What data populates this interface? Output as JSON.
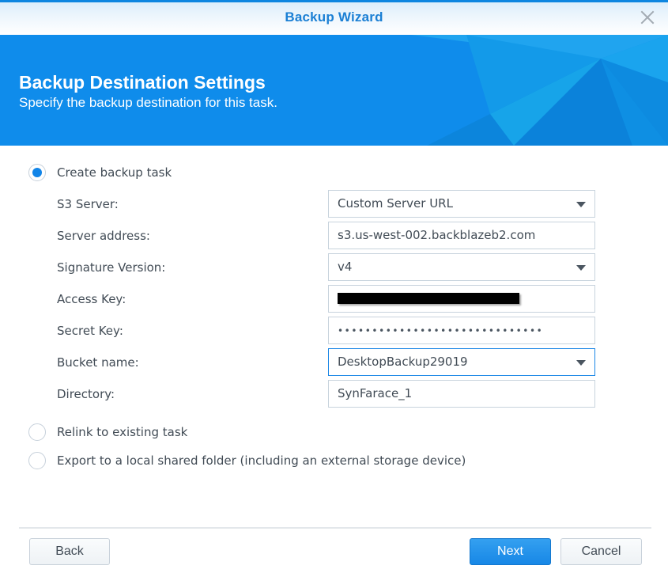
{
  "window": {
    "title": "Backup Wizard",
    "close_icon": "close-icon"
  },
  "banner": {
    "title": "Backup Destination Settings",
    "subtitle": "Specify the backup destination for this task."
  },
  "options": [
    {
      "label": "Create backup task",
      "checked": true
    },
    {
      "label": "Relink to existing task",
      "checked": false
    },
    {
      "label": "Export to a local shared folder (including an external storage device)",
      "checked": false
    }
  ],
  "form": {
    "s3_server": {
      "label": "S3 Server:",
      "value": "Custom Server URL",
      "type": "select"
    },
    "server_address": {
      "label": "Server address:",
      "value": "s3.us-west-002.backblazeb2.com",
      "type": "text"
    },
    "signature_version": {
      "label": "Signature Version:",
      "value": "v4",
      "type": "select"
    },
    "access_key": {
      "label": "Access Key:",
      "value": "[redacted]",
      "type": "text"
    },
    "secret_key": {
      "label": "Secret Key:",
      "value": "••••••••••••••••••••••••••••••",
      "type": "password"
    },
    "bucket_name": {
      "label": "Bucket name:",
      "value": "DesktopBackup29019",
      "type": "select",
      "focused": true
    },
    "directory": {
      "label": "Directory:",
      "value": "SynFarace_1",
      "type": "text"
    }
  },
  "footer": {
    "back_label": "Back",
    "next_label": "Next",
    "cancel_label": "Cancel"
  },
  "colors": {
    "accent": "#1285e8",
    "title_text": "#1a7fd4",
    "banner_bg": "#0f8ceb",
    "body_text": "#414b55"
  }
}
